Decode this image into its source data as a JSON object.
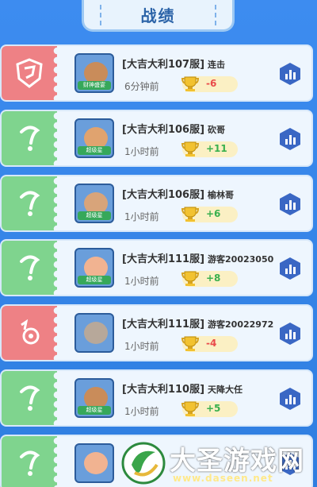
{
  "header": {
    "title": "战绩"
  },
  "records": [
    {
      "result": "special",
      "server": "[大吉大利107服]",
      "player": "连击",
      "time": "6分钟前",
      "score": "-6",
      "score_sign": "neg",
      "rank_label": "财神盛宴",
      "face_color": "#c98c5a"
    },
    {
      "result": "win",
      "server": "[大吉大利106服]",
      "player": "砍哥",
      "time": "1小时前",
      "score": "+11",
      "score_sign": "pos",
      "rank_label": "超级星",
      "face_color": "#e0a36f"
    },
    {
      "result": "win",
      "server": "[大吉大利106服]",
      "player": "榆林哥",
      "time": "1小时前",
      "score": "+6",
      "score_sign": "pos",
      "rank_label": "超级星",
      "face_color": "#d8a47a"
    },
    {
      "result": "win",
      "server": "[大吉大利111服]",
      "player": "游客20023050",
      "time": "1小时前",
      "score": "+8",
      "score_sign": "pos",
      "rank_label": "超级星",
      "face_color": "#f1b391"
    },
    {
      "result": "lose",
      "server": "[大吉大利111服]",
      "player": "游客20022972",
      "time": "1小时前",
      "score": "-4",
      "score_sign": "neg",
      "rank_label": "",
      "face_color": "#b7a89a"
    },
    {
      "result": "win",
      "server": "[大吉大利110服]",
      "player": "天降大任",
      "time": "1小时前",
      "score": "+5",
      "score_sign": "pos",
      "rank_label": "超级星",
      "face_color": "#c98c5a"
    },
    {
      "result": "win",
      "server": "",
      "player": "",
      "time": "",
      "score": "",
      "score_sign": "pos",
      "rank_label": "",
      "face_color": "#f1b391"
    }
  ],
  "watermark": {
    "title": "大圣游戏网",
    "url": "www.daseen.net"
  },
  "colors": {
    "win": "#7fd48e",
    "lose": "#ee8185",
    "background": "#2f7fe0"
  }
}
